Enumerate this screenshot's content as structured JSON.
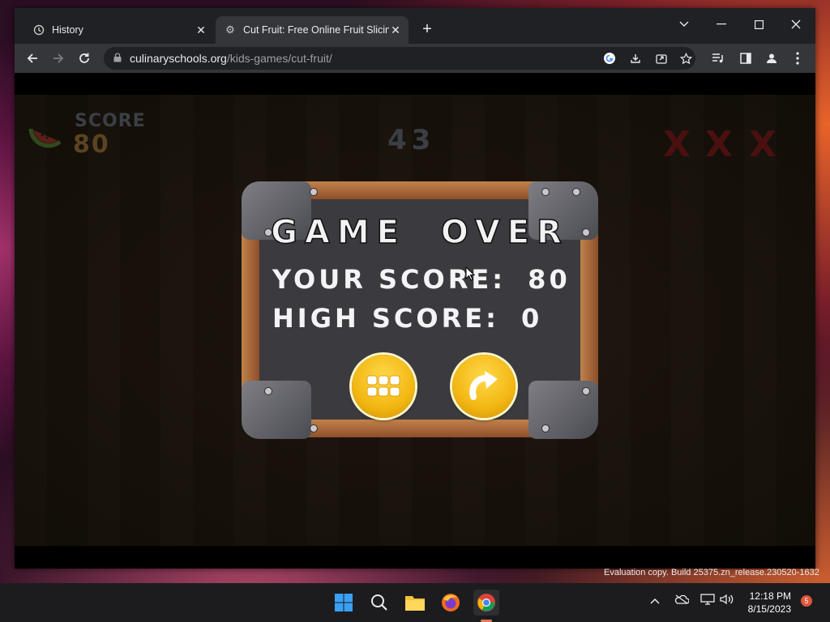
{
  "browser": {
    "tabs": [
      {
        "label": "History",
        "icon": "history-icon",
        "active": false
      },
      {
        "label": "Cut Fruit: Free Online Fruit Slicing",
        "icon": "gear-icon",
        "active": true
      }
    ],
    "url_host": "culinaryschools.org",
    "url_path": "/kids-games/cut-fruit/"
  },
  "game": {
    "hud": {
      "score_label": "SCORE",
      "score_value": "80",
      "timer": "43",
      "strikes": [
        "X",
        "X",
        "X"
      ]
    },
    "game_over": {
      "title": "GAME OVER",
      "your_score_label": "YOUR SCORE:",
      "your_score_value": "80",
      "high_score_label": "HIGH SCORE:",
      "high_score_value": "0",
      "buttons": [
        "menu-grid-icon",
        "replay-icon"
      ]
    }
  },
  "taskbar": {
    "time": "12:18 PM",
    "date": "8/15/2023",
    "notification_count": "5",
    "apps": [
      "start-icon",
      "search-icon",
      "file-explorer-icon",
      "firefox-icon",
      "chrome-icon"
    ]
  },
  "watermark": "Evaluation copy. Build 25375.zn_release.230520-1632"
}
